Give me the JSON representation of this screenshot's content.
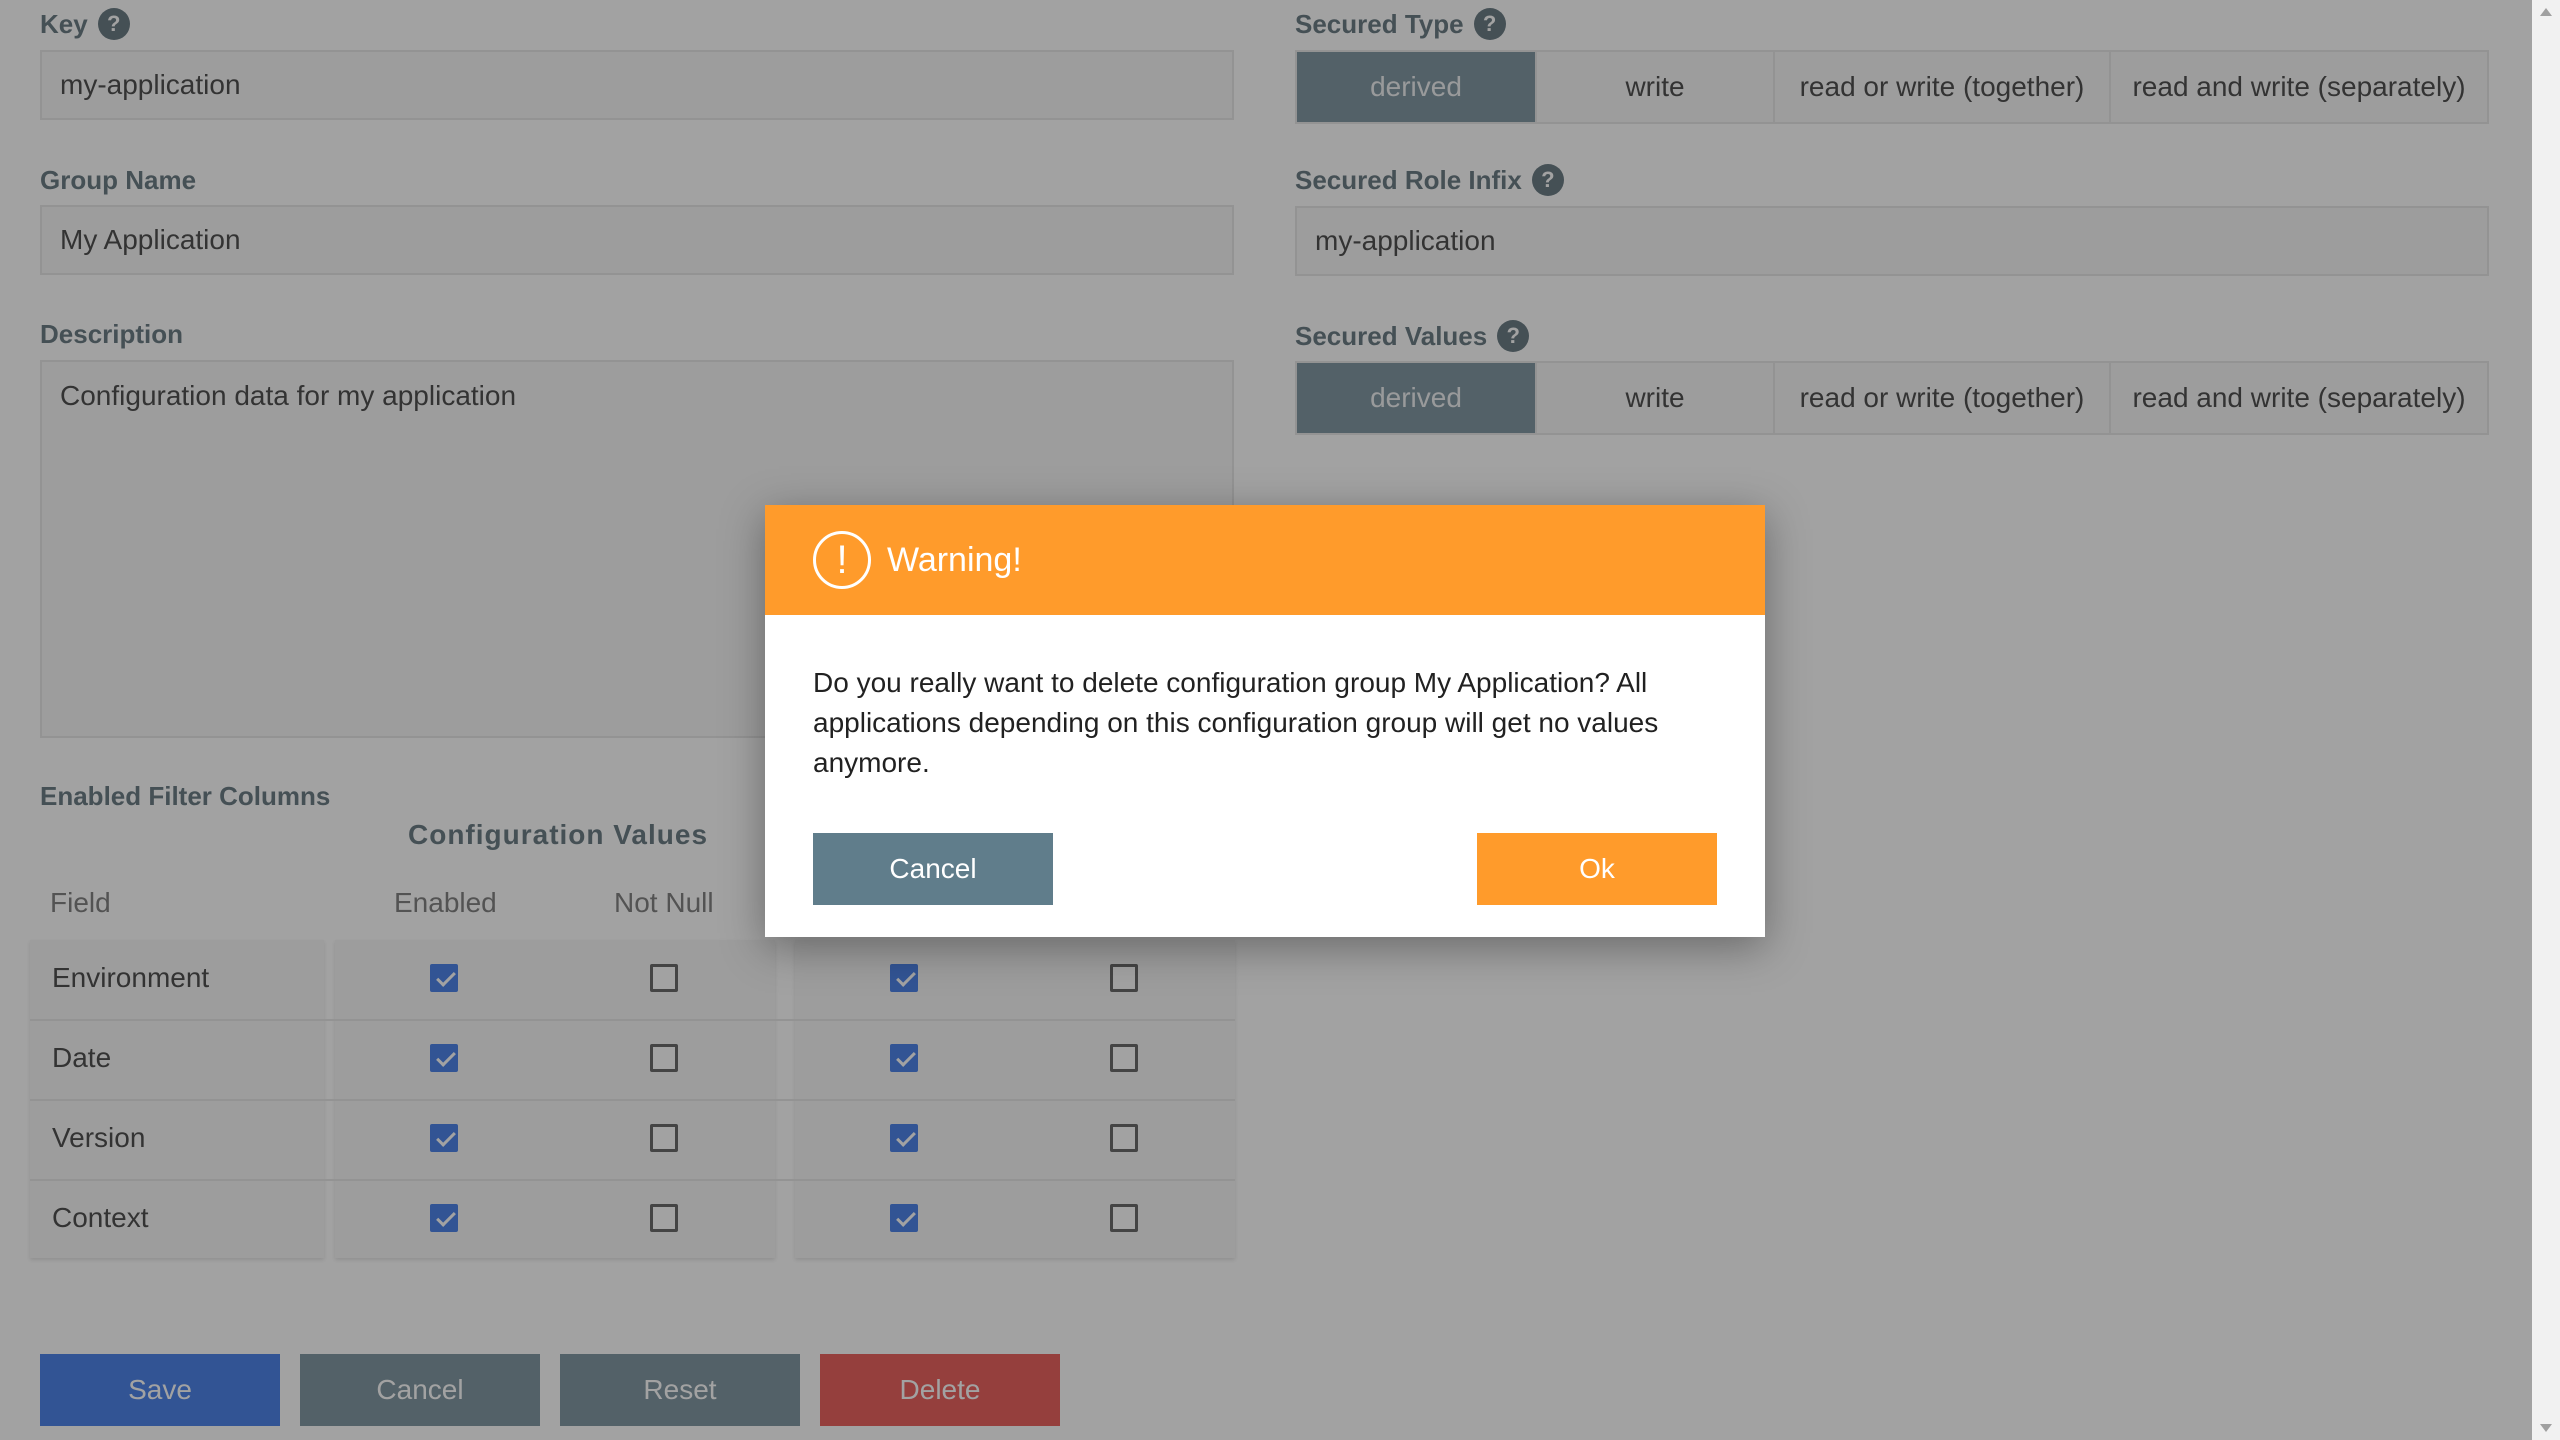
{
  "form": {
    "key_label": "Key",
    "key_value": "my-application",
    "group_name_label": "Group Name",
    "group_name_value": "My Application",
    "description_label": "Description",
    "description_value": "Configuration data for my application",
    "secured_type_label": "Secured Type",
    "secured_role_label": "Secured Role Infix",
    "secured_role_value": "my-application",
    "secured_values_label": "Secured Values",
    "help_glyph": "?"
  },
  "secured_type_options": [
    {
      "label": "derived",
      "active": true
    },
    {
      "label": "write",
      "active": false
    },
    {
      "label": "read or write (together)",
      "active": false
    },
    {
      "label": "read and write (separately)",
      "active": false
    }
  ],
  "secured_values_options": [
    {
      "label": "derived",
      "active": true
    },
    {
      "label": "write",
      "active": false
    },
    {
      "label": "read or write (together)",
      "active": false
    },
    {
      "label": "read and write (separately)",
      "active": false
    }
  ],
  "filter": {
    "section_label": "Enabled Filter Columns",
    "group_title": "Configuration Values",
    "col_field": "Field",
    "col_enabled": "Enabled",
    "col_not_null": "Not Null",
    "rows": [
      {
        "field": "Environment",
        "enabled": true,
        "not_null": false,
        "enabled2": true,
        "not_null2": false
      },
      {
        "field": "Date",
        "enabled": true,
        "not_null": false,
        "enabled2": true,
        "not_null2": false
      },
      {
        "field": "Version",
        "enabled": true,
        "not_null": false,
        "enabled2": true,
        "not_null2": false
      },
      {
        "field": "Context",
        "enabled": true,
        "not_null": false,
        "enabled2": true,
        "not_null2": false
      }
    ]
  },
  "actions": {
    "save": "Save",
    "cancel": "Cancel",
    "reset": "Reset",
    "delete": "Delete"
  },
  "modal": {
    "icon_glyph": "!",
    "title": "Warning!",
    "message": "Do you really want to delete configuration group My Application? All applications depending on this configuration group will get no values anymore.",
    "cancel": "Cancel",
    "ok": "Ok"
  },
  "colors": {
    "primary": "#1e63e3",
    "secondary": "#607d8b",
    "danger": "#e53935",
    "warning": "#ff9b2b"
  }
}
